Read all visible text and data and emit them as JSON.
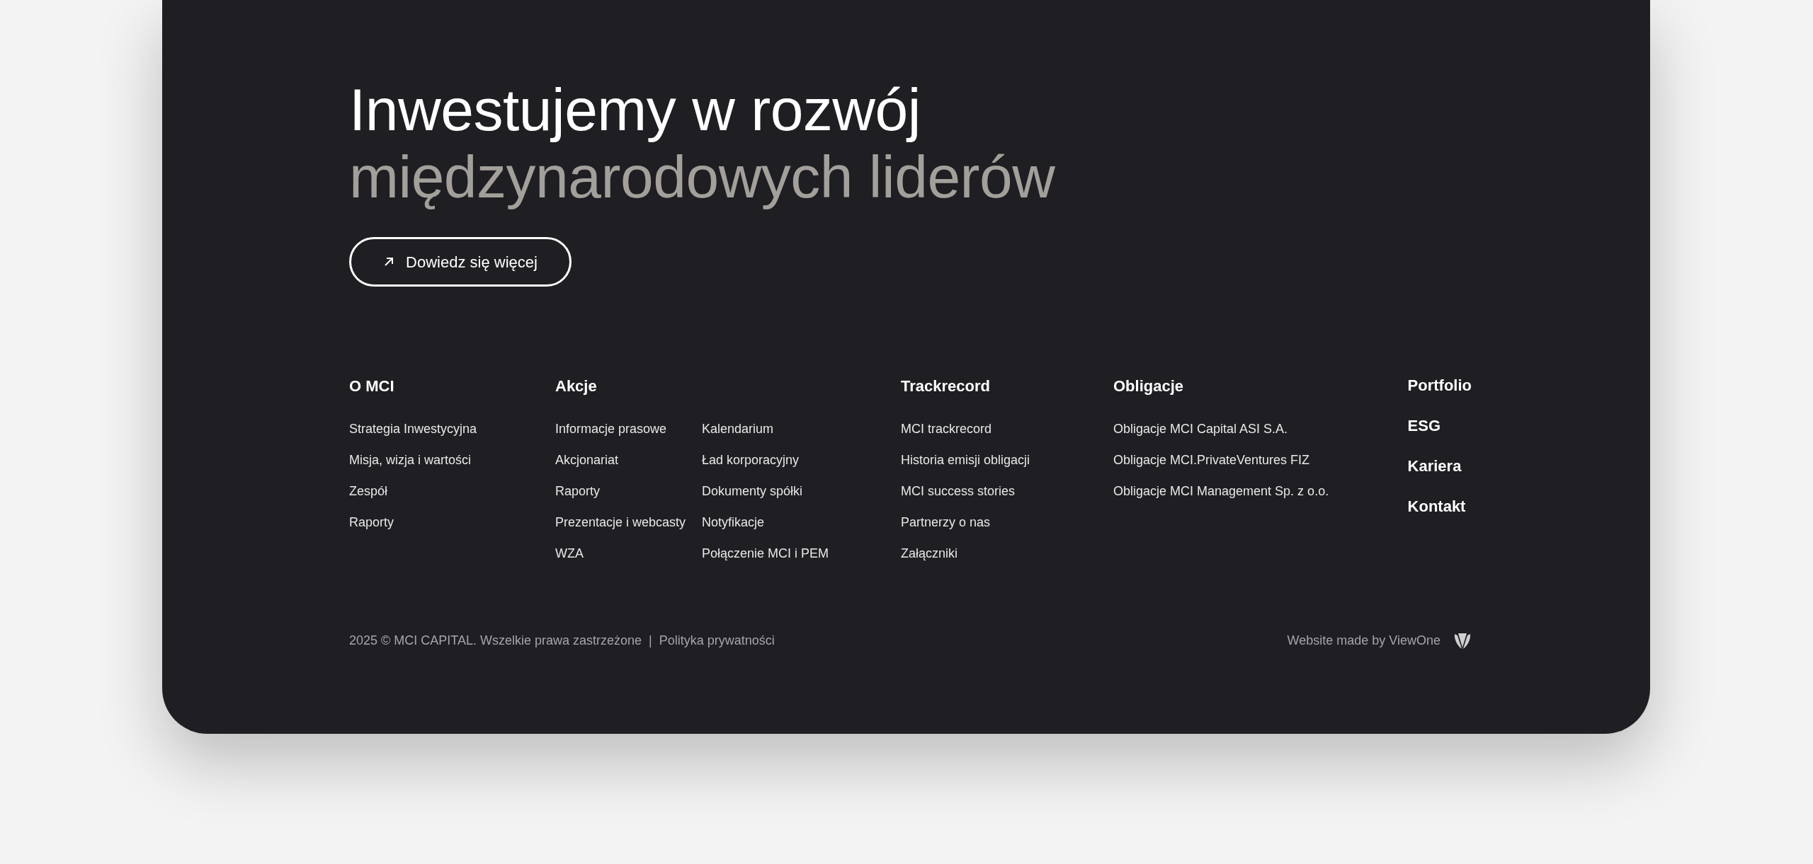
{
  "hero": {
    "title_line_1": "Inwestujemy w rozwój",
    "title_line_2": "międzynarodowych liderów",
    "button": "Dowiedz się więcej"
  },
  "footer_columns": [
    {
      "heading": "O MCI",
      "link_groups": [
        [
          "Strategia Inwestycyjna",
          "Misja, wizja i wartości",
          "Zespół",
          "Raporty"
        ]
      ]
    },
    {
      "heading": "Akcje",
      "link_groups": [
        [
          "Informacje prasowe",
          "Akcjonariat",
          "Raporty",
          "Prezentacje i webcasty",
          "WZA"
        ],
        [
          "Kalendarium",
          "Ład korporacyjny",
          "Dokumenty spółki",
          "Notyfikacje",
          "Połączenie MCI i PEM"
        ]
      ]
    },
    {
      "heading": "Trackrecord",
      "link_groups": [
        [
          "MCI trackrecord",
          "Historia emisji obligacji",
          "MCI success stories",
          "Partnerzy o nas",
          "Załączniki"
        ]
      ]
    },
    {
      "heading": "Obligacje",
      "link_groups": [
        [
          "Obligacje MCI Capital ASI S.A.",
          "Obligacje MCI.PrivateVentures FIZ",
          "Obligacje MCI Management Sp. z o.o."
        ]
      ]
    }
  ],
  "main_links": [
    "Portfolio",
    "ESG",
    "Kariera",
    "Kontakt"
  ],
  "bottom_bar": {
    "copyright": "2025 © MCI CAPITAL. Wszelkie prawa zastrzeżone",
    "separator": "|",
    "privacy_link": "Polityka prywatności",
    "credit": "Website made by ViewOne"
  }
}
